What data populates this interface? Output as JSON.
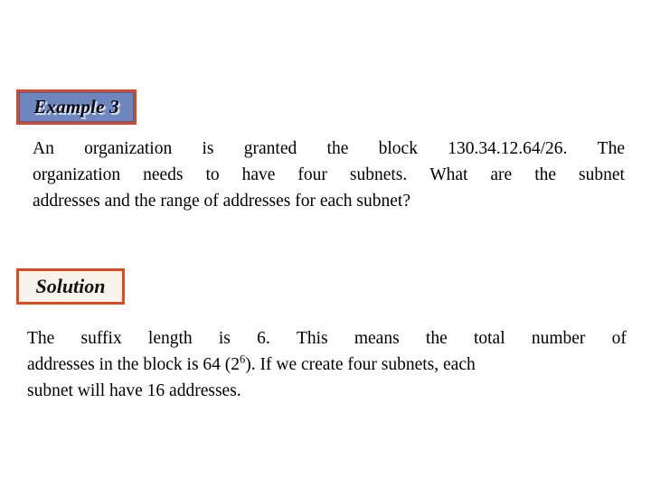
{
  "slide": {
    "background_color": "#ffffff",
    "example_badge": {
      "label": "Example 3",
      "fill_color": "#6d86bd",
      "border_color": "#d4492b",
      "text_color": "#0a0a12"
    },
    "solution_badge": {
      "label": "Solution",
      "fill_color": "#f8f4ec",
      "border_color": "#e0491f",
      "text_color": "#111111"
    },
    "question": {
      "full_text": "An organization is granted the block 130.34.12.64/26. The organization needs to have four subnets. What are the subnet addresses and the range of addresses for each subnet?",
      "lines": [
        [
          "An",
          "organization",
          "is",
          "granted",
          "the",
          "block",
          "130.34.12.64/26.",
          "The"
        ],
        [
          "organization",
          "needs",
          "to",
          "have",
          "four",
          "subnets.",
          "What",
          "are",
          "the",
          "subnet"
        ],
        [
          "addresses and the range of addresses for each subnet?"
        ]
      ],
      "block_prefix": "130.34.12.64",
      "block_suffix_length": "/26",
      "subnet_count": "four"
    },
    "solution": {
      "full_text": "The suffix length is 6. This means the total number of addresses in the block is 64 (26). If we create four subnets, each subnet will have 16 addresses.",
      "lines": [
        [
          "The",
          "suffix",
          "length",
          "is",
          "6.",
          "This",
          "means",
          "the",
          "total",
          "number",
          "of"
        ],
        [
          "addresses in the block is 64 (2",
          "6",
          "). If we create four subnets, each"
        ],
        [
          "subnet will have 16 addresses."
        ]
      ],
      "suffix_length": "6",
      "total_addresses": "64",
      "power_base": "2",
      "power_exponent": "6",
      "subnet_count": "four",
      "addresses_per_subnet": "16"
    }
  }
}
